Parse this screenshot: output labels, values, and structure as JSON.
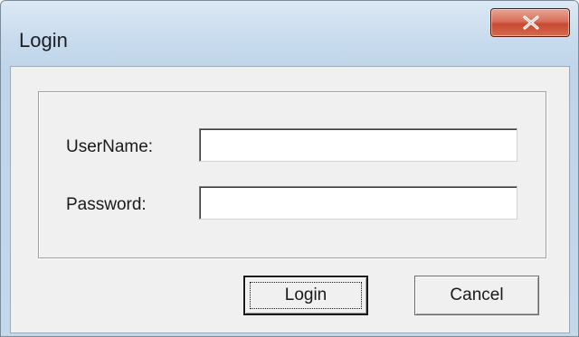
{
  "window": {
    "title": "Login",
    "close_icon": "close-icon"
  },
  "form": {
    "username_label": "UserName:",
    "username_value": "",
    "password_label": "Password:",
    "password_value": ""
  },
  "buttons": {
    "login_label": "Login",
    "cancel_label": "Cancel"
  },
  "colors": {
    "title_bar": "#c9dcee",
    "close_button": "#c74a32",
    "client_background": "#f0f0f0"
  }
}
